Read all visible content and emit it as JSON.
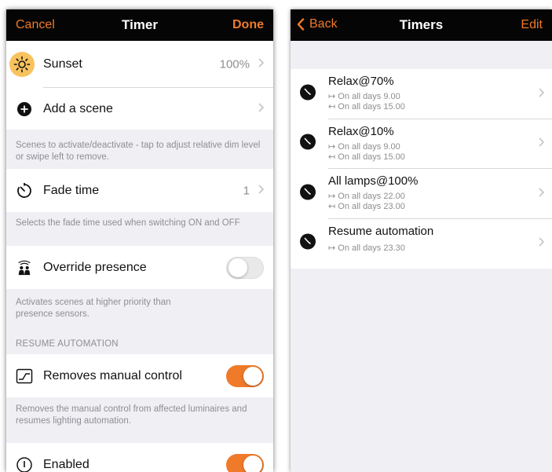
{
  "timer_screen": {
    "nav": {
      "cancel": "Cancel",
      "title": "Timer",
      "done": "Done"
    },
    "sunset": {
      "label": "Sunset",
      "value": "100%"
    },
    "add_scene": {
      "label": "Add a scene"
    },
    "scenes_note": "Scenes to activate/deactivate - tap to adjust relative dim level or swipe left to remove.",
    "fade_time": {
      "label": "Fade time",
      "value": "1"
    },
    "fade_note": "Selects the fade time used when switching ON and OFF",
    "override_presence": {
      "label": "Override presence",
      "on": false
    },
    "override_note": "Activates scenes at higher priority than presence sensors.",
    "resume_header": "RESUME AUTOMATION",
    "removes_manual": {
      "label": "Removes manual control",
      "on": true
    },
    "removes_note": "Removes the manual control from affected luminaires and resumes lighting automation.",
    "enabled": {
      "label": "Enabled",
      "on": true
    }
  },
  "timers_screen": {
    "nav": {
      "back": "Back",
      "title": "Timers",
      "edit": "Edit"
    },
    "timers": [
      {
        "name": "Relax@70%",
        "lines": [
          "↦ On all days 9.00",
          "↤ On all days 15.00"
        ]
      },
      {
        "name": "Relax@10%",
        "lines": [
          "↦ On all days 9.00",
          "↤ On all days 15.00"
        ]
      },
      {
        "name": "All lamps@100%",
        "lines": [
          "↦ On all days 22.00",
          "↤ On all days 23.00"
        ]
      },
      {
        "name": "Resume automation",
        "lines": [
          "↦ On all days 23.30"
        ]
      }
    ]
  },
  "colors": {
    "accent": "#ef7a29",
    "navbar": "#050505",
    "group_bg": "#efeff4",
    "secondary_text": "#8e8e93"
  }
}
